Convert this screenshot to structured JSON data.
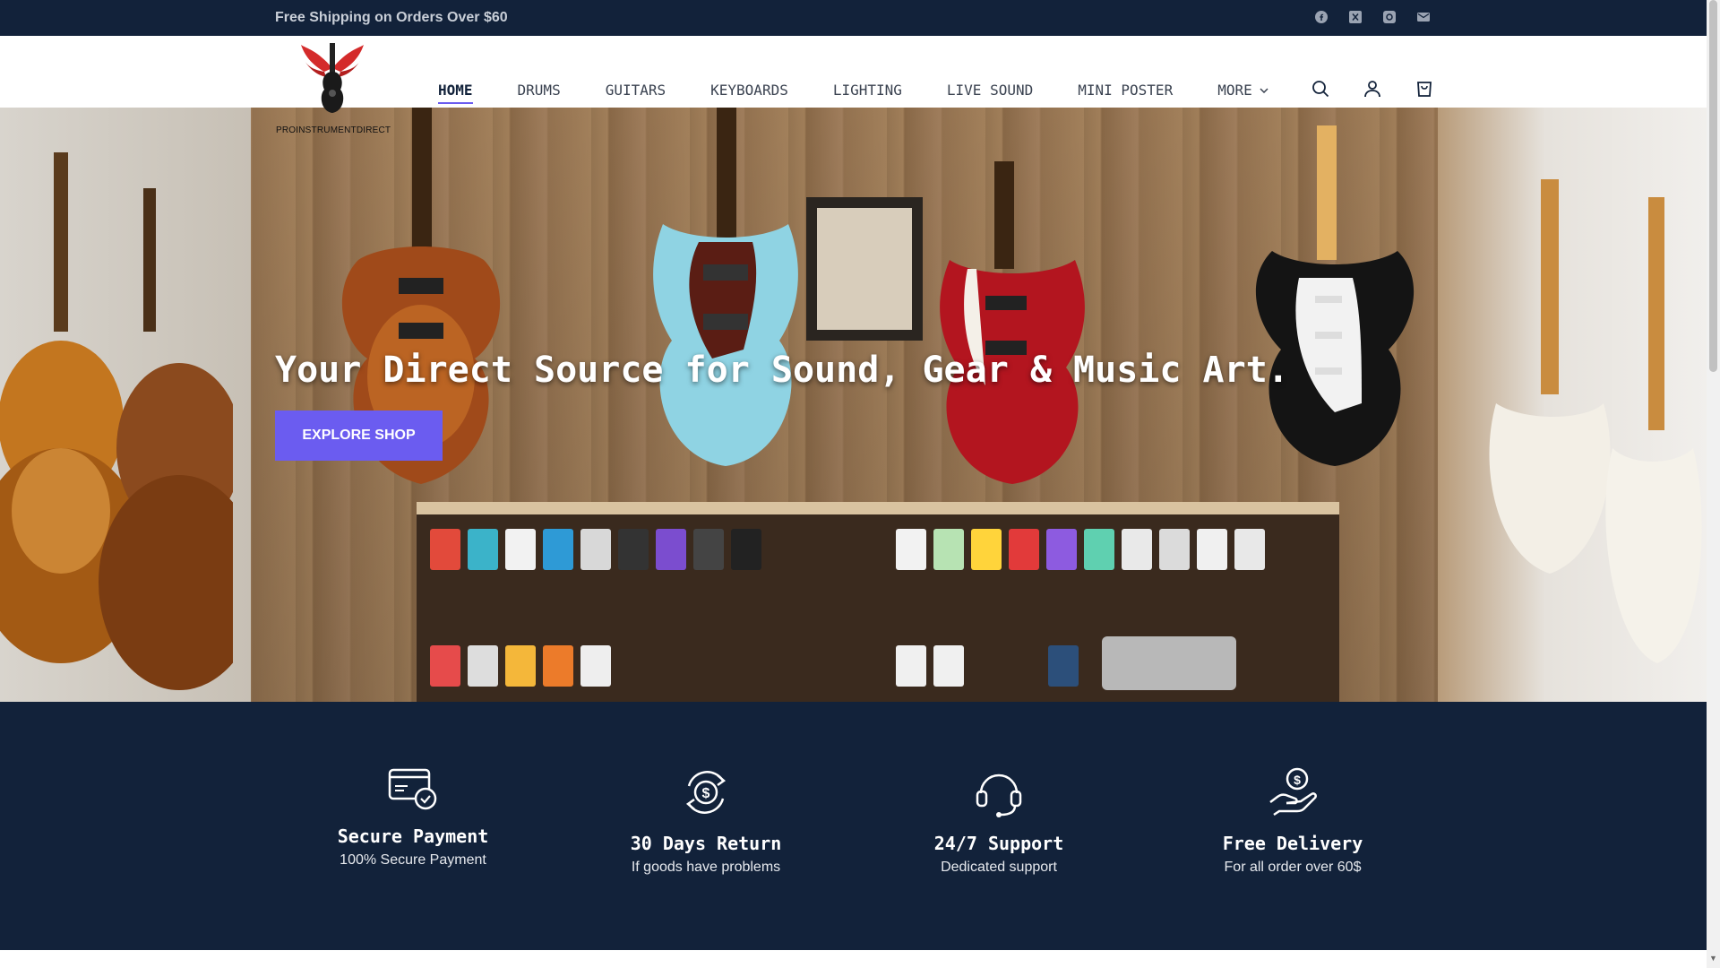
{
  "announcement": {
    "text": "Free Shipping on Orders Over $60"
  },
  "socials": [
    {
      "name": "facebook"
    },
    {
      "name": "x"
    },
    {
      "name": "instagram"
    },
    {
      "name": "email"
    }
  ],
  "brand": {
    "name": "PROINSTRUMENTDIRECT",
    "logo_color": "#d42b2b"
  },
  "nav": {
    "items": [
      {
        "label": "HOME",
        "active": true
      },
      {
        "label": "DRUMS"
      },
      {
        "label": "GUITARS"
      },
      {
        "label": "KEYBOARDS"
      },
      {
        "label": "LIGHTING"
      },
      {
        "label": "LIVE SOUND"
      },
      {
        "label": "MINI POSTER"
      }
    ],
    "more_label": "MORE"
  },
  "hero": {
    "title": "Your Direct Source for Sound, Gear & Music Art.",
    "button_label": "EXPLORE SHOP"
  },
  "features": [
    {
      "icon": "secure-payment-icon",
      "title": "Secure Payment",
      "subtitle": "100% Secure Payment"
    },
    {
      "icon": "return-icon",
      "title": "30 Days Return",
      "subtitle": "If goods have problems"
    },
    {
      "icon": "support-icon",
      "title": "24/7 Support",
      "subtitle": "Dedicated support"
    },
    {
      "icon": "delivery-icon",
      "title": "Free Delivery",
      "subtitle": "For all order over 60$"
    }
  ],
  "colors": {
    "dark": "#12223a",
    "accent": "#6b5cf0"
  }
}
